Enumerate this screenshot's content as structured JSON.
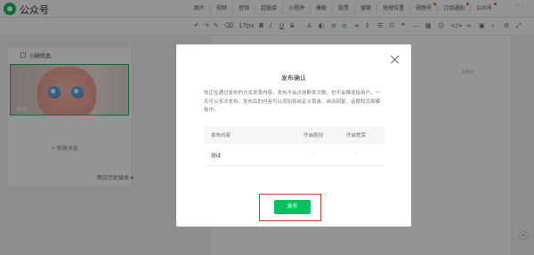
{
  "app": {
    "title": "公众号"
  },
  "tool_tabs": [
    {
      "label": "图片",
      "dot": false
    },
    {
      "label": "视频",
      "dot": false
    },
    {
      "label": "音频",
      "dot": false
    },
    {
      "label": "超链接",
      "dot": false
    },
    {
      "label": "小程序",
      "dot": false
    },
    {
      "label": "模板",
      "dot": false
    },
    {
      "label": "投票",
      "dot": false
    },
    {
      "label": "搜索",
      "dot": false
    },
    {
      "label": "地理位置",
      "dot": false
    },
    {
      "label": "视频号",
      "dot": true
    },
    {
      "label": "订阅通知",
      "dot": true
    },
    {
      "label": "公众号",
      "dot": true
    }
  ],
  "format_toolbar": {
    "font_size": "17px"
  },
  "sidebar": {
    "account_name": "小顾优品",
    "cover_caption": "测试",
    "new_message_label": "+ 新建消息",
    "history_label": "图文历史版本 ▾"
  },
  "editor": {
    "word_count": "2/64"
  },
  "dialog": {
    "title": "发布确认",
    "description": "你正在通过发布的方式发表内容。发布不会占用群发次数，也不会推送给用户。一天可以多次发布。发布后的内容可以添加到自定义菜单、自动回复、话题和页面模板中。",
    "table": {
      "headers": [
        "发布内容",
        "开启原创",
        "开启赞赏"
      ],
      "rows": [
        {
          "content": "测试",
          "original": "--",
          "reward": "--"
        }
      ]
    },
    "publish_button": "发布"
  },
  "colors": {
    "brand": "#07c160",
    "highlight": "#e5322d"
  }
}
